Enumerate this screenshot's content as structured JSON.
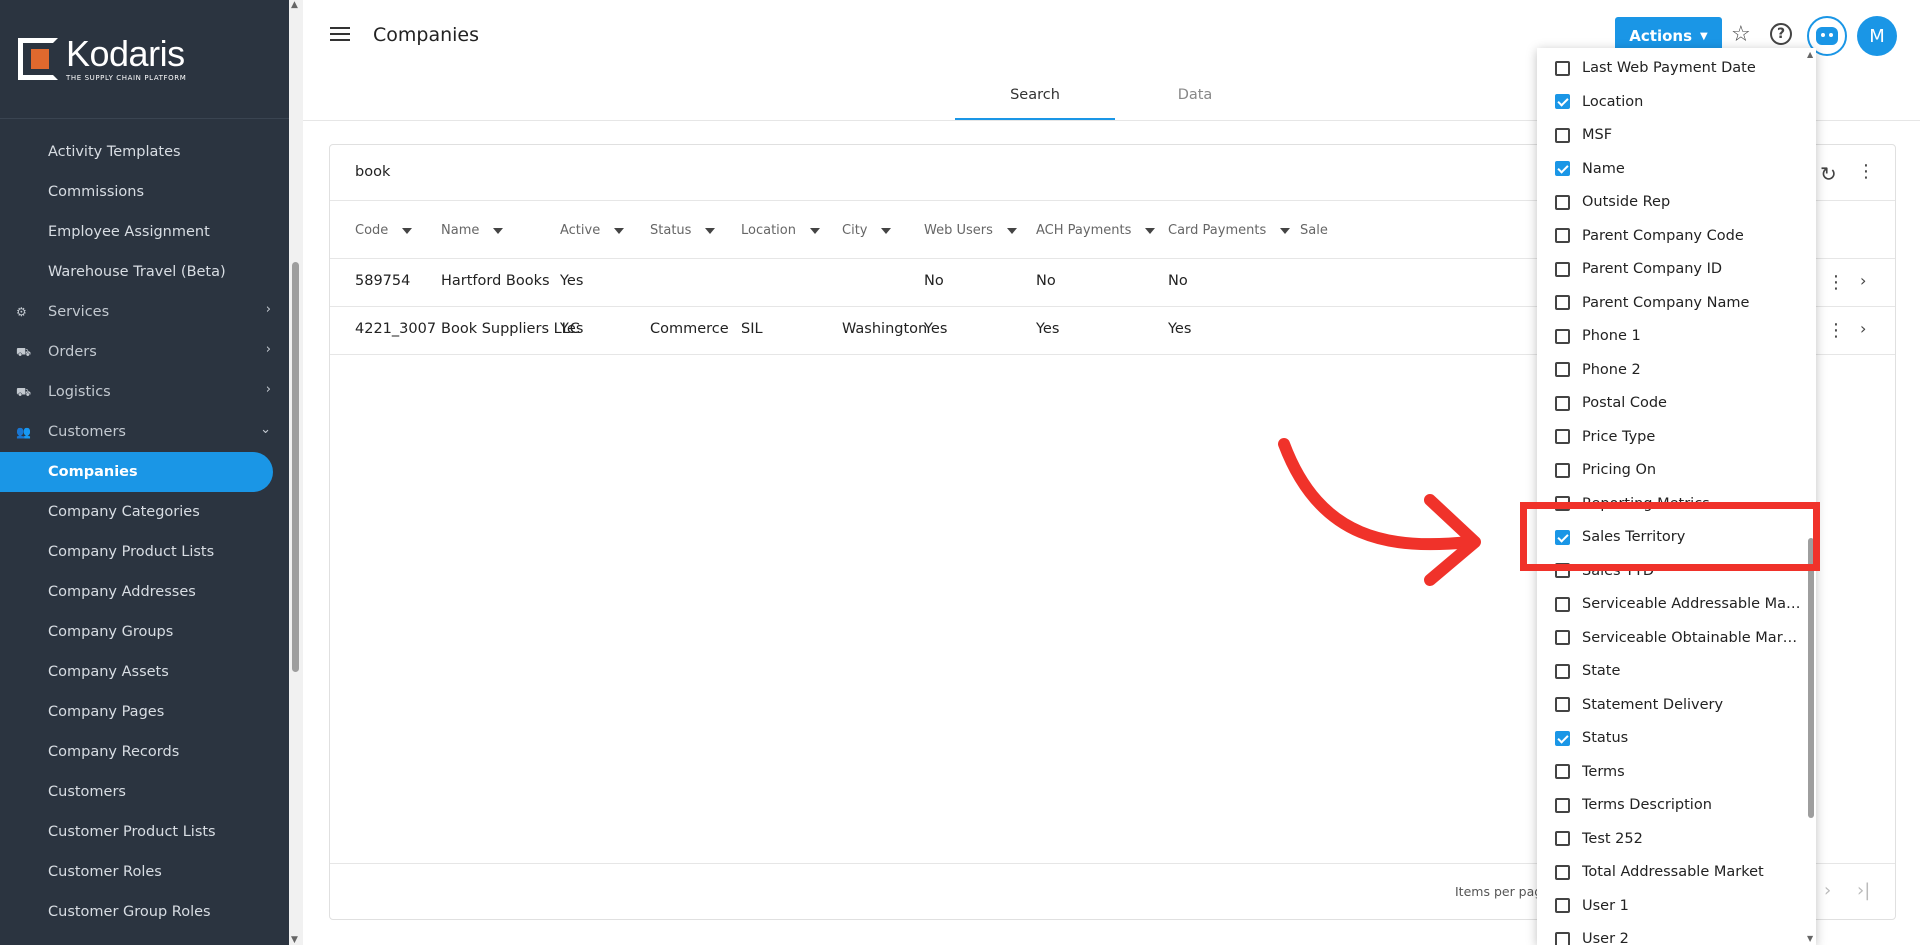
{
  "app": {
    "logo_name": "Kodaris",
    "logo_tagline": "THE SUPPLY CHAIN PLATFORM"
  },
  "sidebar": {
    "items": [
      {
        "label": "Activity Templates",
        "type": "link"
      },
      {
        "label": "Commissions",
        "type": "link"
      },
      {
        "label": "Employee Assignment",
        "type": "link"
      },
      {
        "label": "Warehouse Travel (Beta)",
        "type": "link"
      },
      {
        "label": "Services",
        "type": "section",
        "icon": "gears-icon",
        "chevron": "chevron-right-icon"
      },
      {
        "label": "Orders",
        "type": "section",
        "icon": "truck-icon",
        "chevron": "chevron-right-icon"
      },
      {
        "label": "Logistics",
        "type": "section",
        "icon": "delivery-truck-icon",
        "chevron": "chevron-right-icon"
      },
      {
        "label": "Customers",
        "type": "section",
        "icon": "people-icon",
        "chevron": "chevron-down-icon"
      },
      {
        "label": "Companies",
        "type": "link",
        "active": true
      },
      {
        "label": "Company Categories",
        "type": "link"
      },
      {
        "label": "Company Product Lists",
        "type": "link"
      },
      {
        "label": "Company Addresses",
        "type": "link"
      },
      {
        "label": "Company Groups",
        "type": "link"
      },
      {
        "label": "Company Assets",
        "type": "link"
      },
      {
        "label": "Company Pages",
        "type": "link"
      },
      {
        "label": "Company Records",
        "type": "link"
      },
      {
        "label": "Customers",
        "type": "link"
      },
      {
        "label": "Customer Product Lists",
        "type": "link"
      },
      {
        "label": "Customer Roles",
        "type": "link"
      },
      {
        "label": "Customer Group Roles",
        "type": "link"
      }
    ]
  },
  "header": {
    "title": "Companies",
    "actions_label": "Actions",
    "avatar_initial": "M"
  },
  "tabs": [
    {
      "label": "Search",
      "active": true
    },
    {
      "label": "Data",
      "active": false
    }
  ],
  "search": {
    "value": "book"
  },
  "table": {
    "columns": [
      "Code",
      "Name",
      "Active",
      "Status",
      "Location",
      "City",
      "Web Users",
      "ACH Payments",
      "Card Payments",
      "Sale"
    ],
    "rows": [
      {
        "code": "589754",
        "name": "Hartford Books",
        "active": "Yes",
        "status": "",
        "location": "",
        "city": "",
        "web_users": "No",
        "ach": "No",
        "card": "No"
      },
      {
        "code": "4221_3007",
        "name": "Book Suppliers LLC",
        "active": "Yes",
        "status": "Commerce",
        "location": "SIL",
        "city": "Washington",
        "web_users": "Yes",
        "ach": "Yes",
        "card": "Yes"
      }
    ]
  },
  "footer": {
    "items_per_page_label": "Items per page"
  },
  "column_menu": {
    "items": [
      {
        "label": "Last Web Payment Date",
        "checked": false
      },
      {
        "label": "Location",
        "checked": true
      },
      {
        "label": "MSF",
        "checked": false
      },
      {
        "label": "Name",
        "checked": true
      },
      {
        "label": "Outside Rep",
        "checked": false
      },
      {
        "label": "Parent Company Code",
        "checked": false
      },
      {
        "label": "Parent Company ID",
        "checked": false
      },
      {
        "label": "Parent Company Name",
        "checked": false
      },
      {
        "label": "Phone 1",
        "checked": false
      },
      {
        "label": "Phone 2",
        "checked": false
      },
      {
        "label": "Postal Code",
        "checked": false
      },
      {
        "label": "Price Type",
        "checked": false
      },
      {
        "label": "Pricing On",
        "checked": false
      },
      {
        "label": "Reporting Metrics",
        "checked": false
      },
      {
        "label": "Sales Territory",
        "checked": true
      },
      {
        "label": "Sales YTD",
        "checked": false
      },
      {
        "label": "Serviceable Addressable Market",
        "checked": false
      },
      {
        "label": "Serviceable Obtainable Market",
        "checked": false
      },
      {
        "label": "State",
        "checked": false
      },
      {
        "label": "Statement Delivery",
        "checked": false
      },
      {
        "label": "Status",
        "checked": true
      },
      {
        "label": "Terms",
        "checked": false
      },
      {
        "label": "Terms Description",
        "checked": false
      },
      {
        "label": "Test 252",
        "checked": false
      },
      {
        "label": "Total Addressable Market",
        "checked": false
      },
      {
        "label": "User 1",
        "checked": false
      },
      {
        "label": "User 2",
        "checked": false
      }
    ]
  },
  "colors": {
    "accent": "#1a96e6",
    "sidebar_bg": "#2b3440",
    "annotation": "#f0322a",
    "logo_orange": "#e0692e"
  }
}
